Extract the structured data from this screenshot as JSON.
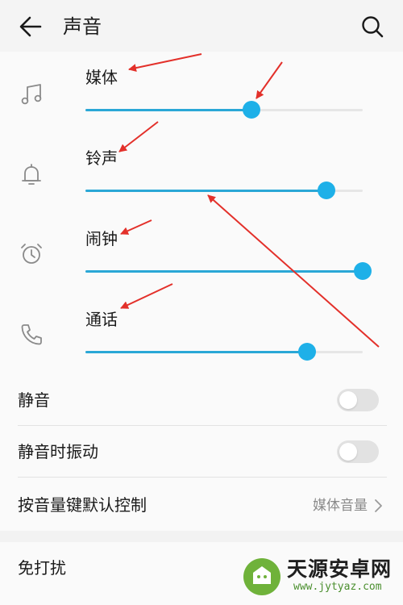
{
  "header": {
    "title": "声音",
    "back_icon": "arrow-left-icon",
    "search_icon": "search-icon"
  },
  "volumes": [
    {
      "label": "媒体",
      "icon": "music-note-icon",
      "level": 0.6
    },
    {
      "label": "铃声",
      "icon": "bell-icon",
      "level": 0.87
    },
    {
      "label": "闹钟",
      "icon": "alarm-clock-icon",
      "level": 1.0
    },
    {
      "label": "通话",
      "icon": "phone-icon",
      "level": 0.8
    }
  ],
  "settings": {
    "mute_label": "静音",
    "mute_on": false,
    "vibrate_label": "静音时振动",
    "vibrate_on": false,
    "volume_key_label": "按音量键默认控制",
    "volume_key_value": "媒体音量"
  },
  "dnd_label": "免打扰",
  "watermark": {
    "text": "天源安卓网",
    "url": "www.jytyaz.com"
  },
  "colors": {
    "accent": "#1eb0e8",
    "annotation": "#e3302a",
    "switch_off": "#e2e2e2"
  }
}
